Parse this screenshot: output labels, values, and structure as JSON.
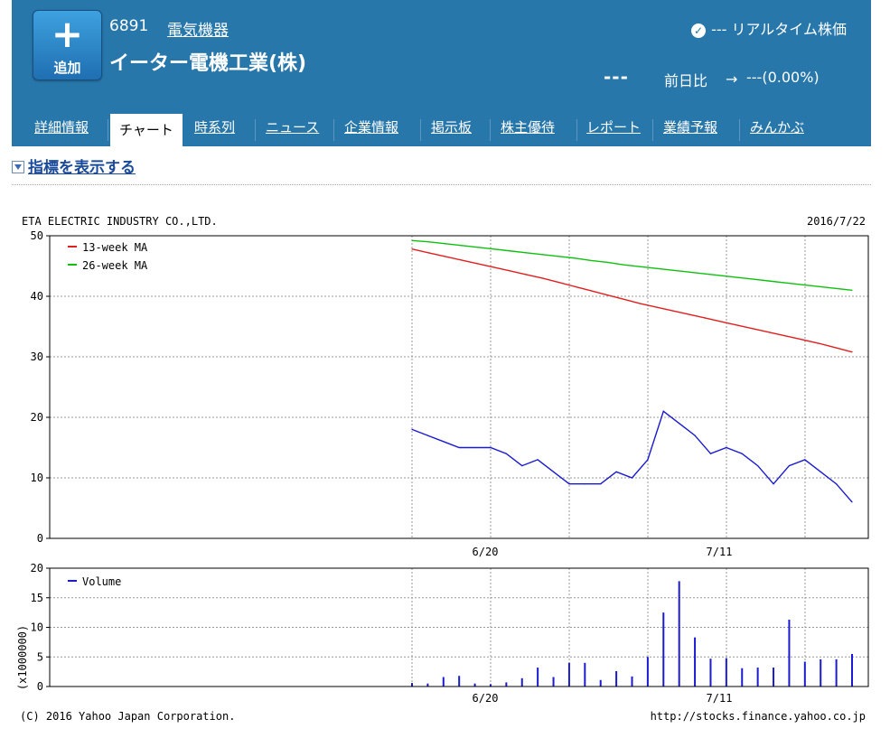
{
  "header": {
    "add_label": "追加",
    "add_symbol": "+",
    "code": "6891",
    "sector": "電気機器",
    "company": "イーター電機工業(株)",
    "realtime": "--- リアルタイム株価",
    "price": "---",
    "prev_label": "前日比",
    "change": "---(0.00%)"
  },
  "tabs": [
    "詳細情報",
    "チャート",
    "時系列",
    "ニュース",
    "企業情報",
    "掲示板",
    "株主優待",
    "レポート",
    "業績予報",
    "みんかぶ"
  ],
  "active_tab": "チャート",
  "indicator_link": "指標を表示する",
  "colors": {
    "header_bg": "#2777ab",
    "ma13": "#e02020",
    "ma26": "#10c010",
    "price": "#1a1ad0",
    "volume": "#1a1ad0"
  },
  "chart_data": [
    {
      "type": "line",
      "title": "ETA ELECTRIC INDUSTRY CO.,LTD.",
      "date_label": "2016/7/22",
      "x_ticks": [
        "6/20",
        "7/11"
      ],
      "ylim": [
        0,
        50
      ],
      "y_ticks": [
        0,
        10,
        20,
        30,
        40,
        50
      ],
      "grid": true,
      "legend_position": "top-left",
      "series": [
        {
          "name": "13-week MA",
          "color": "#e02020",
          "values": [
            47.8,
            47.2,
            46.6,
            46.0,
            45.4,
            44.8,
            44.2,
            43.6,
            43.0,
            42.3,
            41.6,
            40.9,
            40.2,
            39.5,
            38.8,
            38.2,
            37.6,
            37.0,
            36.4,
            35.8,
            35.2,
            34.6,
            34.0,
            33.4,
            32.8,
            32.2,
            31.5,
            30.8
          ]
        },
        {
          "name": "26-week MA",
          "color": "#10c010",
          "values": [
            49.2,
            49.0,
            48.7,
            48.4,
            48.1,
            47.8,
            47.5,
            47.2,
            46.9,
            46.6,
            46.3,
            45.9,
            45.6,
            45.2,
            44.9,
            44.6,
            44.3,
            44.0,
            43.7,
            43.4,
            43.1,
            42.8,
            42.5,
            42.2,
            41.9,
            41.6,
            41.3,
            41.0
          ]
        },
        {
          "name": "",
          "color": "#1a1ad0",
          "values": [
            18,
            17,
            16,
            15,
            15,
            15,
            14,
            12,
            13,
            11,
            9,
            9,
            9,
            11,
            10,
            13,
            21,
            19,
            17,
            14,
            15,
            14,
            12,
            9,
            12,
            13,
            11,
            9,
            6
          ]
        }
      ]
    },
    {
      "type": "bar",
      "ylabel": "(x1000000)",
      "ylim": [
        0,
        20
      ],
      "y_ticks": [
        0,
        5,
        10,
        15,
        20
      ],
      "x_ticks": [
        "6/20",
        "7/11"
      ],
      "grid": true,
      "legend_position": "top-left",
      "series": [
        {
          "name": "Volume",
          "color": "#1a1ad0",
          "values": [
            0.6,
            0.5,
            1.6,
            1.8,
            0.5,
            0.4,
            0.7,
            1.4,
            3.2,
            1.6,
            4.0,
            4.0,
            1.1,
            2.6,
            1.7,
            5.0,
            12.5,
            17.8,
            8.3,
            4.7,
            4.8,
            3.1,
            3.2,
            3.2,
            11.3,
            4.2,
            4.6,
            4.6,
            5.5
          ]
        }
      ]
    }
  ],
  "footer": {
    "copyright": "(C) 2016 Yahoo Japan Corporation.",
    "url": "http://stocks.finance.yahoo.co.jp"
  }
}
